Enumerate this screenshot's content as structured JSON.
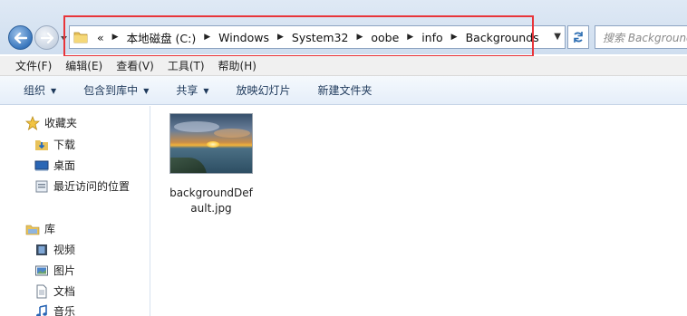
{
  "address": {
    "overflow": "«",
    "crumbs": [
      "本地磁盘 (C:)",
      "Windows",
      "System32",
      "oobe",
      "info",
      "Backgrounds"
    ]
  },
  "search": {
    "placeholder": "搜索 Backgrounds"
  },
  "menu": [
    "文件(F)",
    "编辑(E)",
    "查看(V)",
    "工具(T)",
    "帮助(H)"
  ],
  "commands": {
    "organize": "组织",
    "include_library": "包含到库中",
    "share": "共享",
    "slideshow": "放映幻灯片",
    "new_folder": "新建文件夹"
  },
  "nav": {
    "favorites": "收藏夹",
    "downloads": "下载",
    "desktop": "桌面",
    "recent": "最近访问的位置",
    "libraries": "库",
    "videos": "视频",
    "pictures": "图片",
    "documents": "文档",
    "music": "音乐"
  },
  "files": [
    {
      "name": "backgroundDefault.jpg"
    }
  ],
  "colors": {
    "highlight": "#e8353a",
    "chrome": "#dfe9f5"
  }
}
